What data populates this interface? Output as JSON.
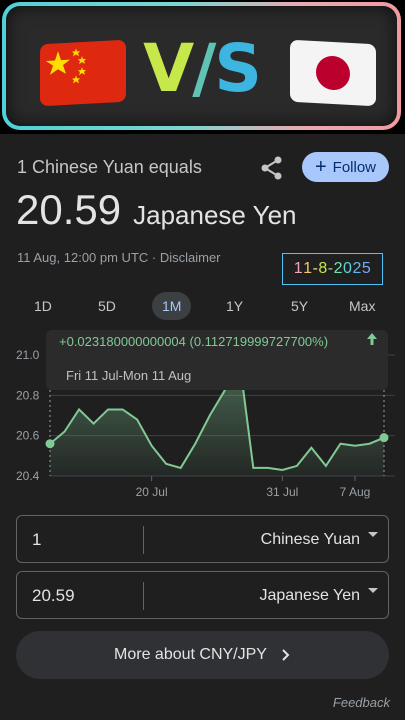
{
  "banner": {
    "vs_text": [
      "V",
      "/",
      "S"
    ],
    "left_flag": "china-flag",
    "right_flag": "japan-flag",
    "colors": {
      "border_start": "#4fd0d8",
      "border_end": "#f09aa0"
    }
  },
  "header": {
    "subtitle": "1 Chinese Yuan equals",
    "follow_label": "Follow",
    "rate_value": "20.59",
    "rate_currency": "Japanese Yen",
    "timestamp": "11 Aug, 12:00 pm UTC · Disclaimer",
    "date_badge": [
      "1",
      "1",
      "-",
      "8",
      "-",
      "2",
      "0",
      "2",
      "5"
    ]
  },
  "tabs": [
    {
      "label": "1D",
      "active": false
    },
    {
      "label": "5D",
      "active": false
    },
    {
      "label": "1M",
      "active": true
    },
    {
      "label": "1Y",
      "active": false
    },
    {
      "label": "5Y",
      "active": false
    },
    {
      "label": "Max",
      "active": false
    }
  ],
  "tooltip": {
    "change": "+0.023180000000004 (0.112719999727700%)",
    "range": "Fri 11 Jul-Mon 11 Aug"
  },
  "chart_data": {
    "type": "area",
    "y_ticks": [
      "21.0",
      "20.8",
      "20.6",
      "20.4"
    ],
    "ylim": [
      20.4,
      21.0
    ],
    "x_ticks": [
      "20 Jul",
      "31 Jul",
      "7 Aug"
    ],
    "values": [
      20.56,
      20.62,
      20.73,
      20.66,
      20.73,
      20.73,
      20.68,
      20.55,
      20.46,
      20.44,
      20.56,
      20.7,
      20.82,
      21.0,
      20.44,
      20.44,
      20.43,
      20.45,
      20.54,
      20.45,
      20.56,
      20.55,
      20.56,
      20.59
    ],
    "x_tick_indices": [
      7,
      16,
      21
    ],
    "line_color": "#81c995",
    "grid": true
  },
  "converter": {
    "from_amount": "1",
    "from_currency": "Chinese Yuan",
    "to_amount": "20.59",
    "to_currency": "Japanese Yen"
  },
  "more_label": "More about CNY/JPY",
  "feedback_label": "Feedback"
}
